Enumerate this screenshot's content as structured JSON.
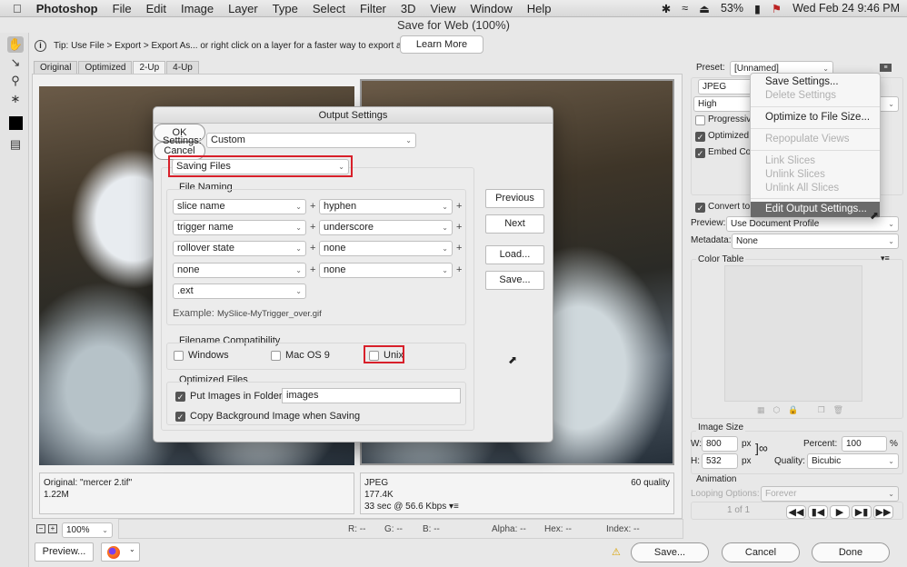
{
  "menubar": {
    "app": "Photoshop",
    "items": [
      "File",
      "Edit",
      "Image",
      "Layer",
      "Type",
      "Select",
      "Filter",
      "3D",
      "View",
      "Window",
      "Help"
    ],
    "battery": "53%",
    "datetime": "Wed Feb 24  9:46 PM"
  },
  "window_title": "Save for Web (100%)",
  "tip": {
    "text": "Tip: Use File > Export > Export As...  or right click on a layer for a faster way to export assets",
    "learn_more": "Learn More"
  },
  "tabs": [
    {
      "label": "Original"
    },
    {
      "label": "Optimized"
    },
    {
      "label": "2-Up",
      "active": true
    },
    {
      "label": "4-Up"
    }
  ],
  "original_info": {
    "name": "Original: \"mercer 2.tif\"",
    "size": "1.22M"
  },
  "optimized_info": {
    "format": "JPEG",
    "size": "177.4K",
    "time": "33 sec @ 56.6 Kbps",
    "quality": "60 quality"
  },
  "bottom": {
    "zoom": "100%",
    "r": "R: --",
    "g": "G: --",
    "b": "B: --",
    "alpha": "Alpha: --",
    "hex": "Hex: --",
    "index": "Index: --"
  },
  "buttons": {
    "preview": "Preview...",
    "save": "Save...",
    "cancel": "Cancel",
    "done": "Done"
  },
  "right_panel": {
    "preset_label": "Preset:",
    "preset": "[Unnamed]",
    "format": "JPEG",
    "quality_level": "High",
    "progressive": "Progressive",
    "optimized": "Optimized",
    "embed": "Embed Color Profile",
    "convert": "Convert to sRGB",
    "preview_label": "Preview:",
    "preview": "Use Document Profile",
    "metadata_label": "Metadata:",
    "metadata": "None",
    "color_table": "Color Table",
    "image_size": "Image Size",
    "w_label": "W:",
    "w": "800",
    "h_label": "H:",
    "h": "532",
    "px": "px",
    "percent_label": "Percent:",
    "percent": "100",
    "pct": "%",
    "quality_label": "Quality:",
    "quality": "Bicubic",
    "animation": "Animation",
    "looping_label": "Looping Options:",
    "looping": "Forever",
    "frame": "1 of 1"
  },
  "flyout_menu": {
    "items": [
      {
        "label": "Save Settings...",
        "enabled": true
      },
      {
        "label": "Delete Settings",
        "enabled": false
      },
      {
        "label": "Optimize to File Size...",
        "enabled": true
      },
      {
        "label": "Repopulate Views",
        "enabled": false
      },
      {
        "label": "Link Slices",
        "enabled": false
      },
      {
        "label": "Unlink Slices",
        "enabled": false
      },
      {
        "label": "Unlink All Slices",
        "enabled": false
      },
      {
        "label": "Edit Output Settings...",
        "enabled": true,
        "highlighted": true
      }
    ]
  },
  "dialog": {
    "title": "Output Settings",
    "settings_label": "Settings:",
    "settings": "Custom",
    "section": "Saving Files",
    "ok": "OK",
    "cancel": "Cancel",
    "previous": "Previous",
    "next": "Next",
    "load": "Load...",
    "save": "Save...",
    "file_naming": "File Naming",
    "naming": [
      [
        "slice name",
        "hyphen"
      ],
      [
        "trigger name",
        "underscore"
      ],
      [
        "rollover state",
        "none"
      ],
      [
        "none",
        "none"
      ]
    ],
    "ext": ".ext",
    "example_label": "Example:",
    "example": "MySlice-MyTrigger_over.gif",
    "compat": "Filename Compatibility",
    "windows": "Windows",
    "macos9": "Mac OS 9",
    "unix": "Unix",
    "optimized_files": "Optimized Files",
    "put_images": "Put Images in Folder:",
    "folder": "images",
    "copy_bg": "Copy Background Image when Saving"
  },
  "colors": {
    "highlight": "#d8202a",
    "menu_selected": "#6a6a6a"
  }
}
